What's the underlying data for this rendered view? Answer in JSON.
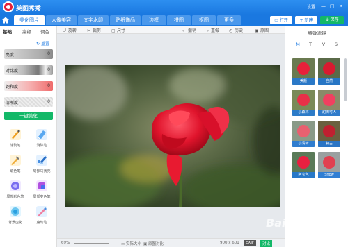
{
  "app": {
    "title": "美图秀秀",
    "settings_label": "设置"
  },
  "nav": {
    "tabs": [
      {
        "label": "美化图片",
        "active": true
      },
      {
        "label": "人像美容",
        "active": false
      },
      {
        "label": "文字水印",
        "active": false
      },
      {
        "label": "贴纸饰品",
        "active": false
      },
      {
        "label": "边框",
        "active": false
      },
      {
        "label": "拼图",
        "active": false
      },
      {
        "label": "抠图",
        "active": false
      },
      {
        "label": "更多",
        "active": false
      }
    ],
    "open_label": "打开",
    "new_label": "新建",
    "save_label": "保存"
  },
  "left_panel": {
    "sub_tabs": [
      "基础",
      "高级",
      "调色"
    ],
    "reset_label": "重置",
    "sliders": [
      {
        "label": "亮度",
        "value": "0"
      },
      {
        "label": "对比度",
        "value": "0"
      },
      {
        "label": "饱和度",
        "value": "0"
      },
      {
        "label": "清晰度",
        "value": "0"
      }
    ],
    "one_key_label": "一键美化",
    "tools": [
      {
        "label": "涂鸦笔",
        "icon": "brush-icon"
      },
      {
        "label": "消除笔",
        "icon": "eraser-icon"
      },
      {
        "label": "取色笔",
        "icon": "pipette-icon"
      },
      {
        "label": "局部马赛克",
        "icon": "mosaic-icon"
      },
      {
        "label": "局部彩色笔",
        "icon": "color-pen-icon"
      },
      {
        "label": "局部变色笔",
        "icon": "recolor-pen-icon"
      },
      {
        "label": "背景虚化",
        "icon": "blur-icon"
      },
      {
        "label": "魔幻笔",
        "icon": "magic-pen-icon"
      }
    ]
  },
  "toolbar": {
    "rotate": "旋转",
    "crop": "裁剪",
    "resize": "尺寸",
    "undo": "撤销",
    "redo": "重做",
    "history": "历史",
    "original": "原图"
  },
  "status": {
    "zoom": "69%",
    "fit_label": "实际大小",
    "compare_label": "原图对比",
    "dimensions": "900 x 601",
    "exif": "EXIF",
    "compare_btn": "对比"
  },
  "right_panel": {
    "title": "特效滤镜",
    "filter_tabs": [
      "M",
      "T",
      "V",
      "S"
    ],
    "filters": [
      "美颜",
      "自然",
      "小森林",
      "甜美可人",
      "小清新",
      "复古",
      "阿宝色",
      "Snow"
    ]
  },
  "watermark": {
    "text": "Baidu 经验",
    "sub": "jingyan.baidu.com"
  },
  "colors": {
    "accent": "#1a78e0",
    "green": "#13b868",
    "rose": "#e4203a"
  }
}
